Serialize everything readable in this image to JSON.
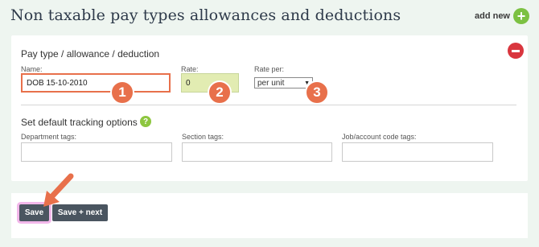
{
  "header": {
    "title": "Non taxable pay types allowances and deductions",
    "add_new_label": "add new"
  },
  "form": {
    "section_title": "Pay type / allowance / deduction",
    "name": {
      "label": "Name:",
      "value": "DOB 15-10-2010"
    },
    "rate": {
      "label": "Rate:",
      "value": "0"
    },
    "rate_per": {
      "label": "Rate per:",
      "selected": "per unit"
    },
    "tracking": {
      "title": "Set default tracking options",
      "department_label": "Department tags:",
      "section_label": "Section tags:",
      "job_label": "Job/account code tags:"
    }
  },
  "annotations": {
    "badge1": "1",
    "badge2": "2",
    "badge3": "3"
  },
  "actions": {
    "save_label": "Save",
    "save_next_label": "Save + next"
  },
  "colors": {
    "accent": "#e8704b",
    "add_green": "#7cc142",
    "remove_red": "#d9363e",
    "button": "#4a5560"
  }
}
